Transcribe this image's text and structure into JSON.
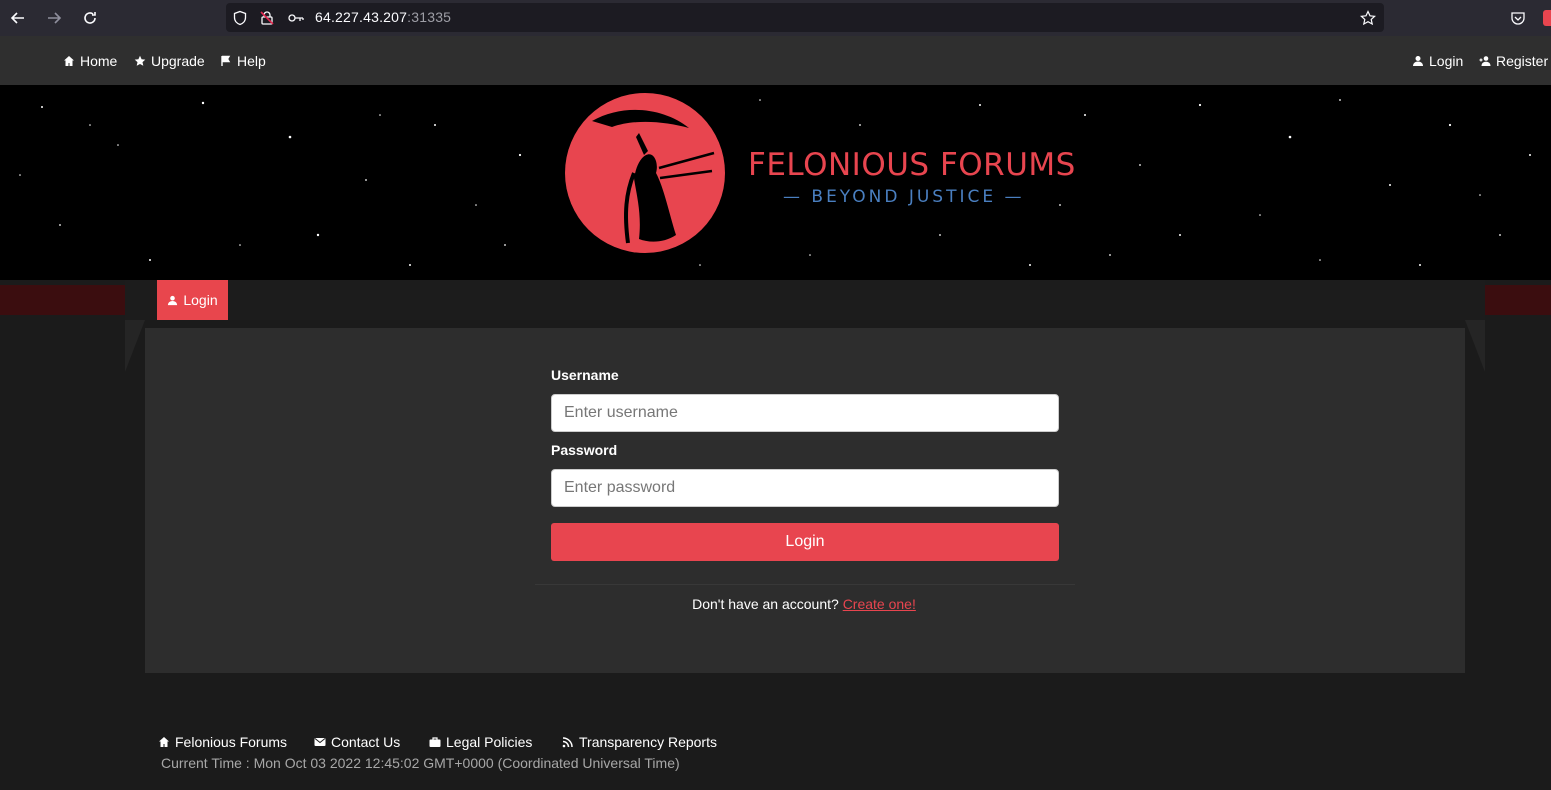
{
  "browser": {
    "url_host": "64.227.43.207",
    "url_port": ":31335"
  },
  "nav": {
    "home": "Home",
    "upgrade": "Upgrade",
    "help": "Help",
    "login": "Login",
    "register": "Register"
  },
  "brand": {
    "title": "FELONIOUS FORUMS",
    "subtitle": "— BEYOND JUSTICE —"
  },
  "tabs": {
    "active": "Login"
  },
  "form": {
    "username_label": "Username",
    "username_placeholder": "Enter username",
    "password_label": "Password",
    "password_placeholder": "Enter password",
    "submit_label": "Login",
    "signup_prompt": "Don't have an account?",
    "signup_link": "Create one!"
  },
  "footer": {
    "links": [
      "Felonious Forums",
      "Contact Us",
      "Legal Policies",
      "Transparency Reports"
    ],
    "time": "Current Time : Mon Oct 03 2022 12:45:02 GMT+0000 (Coordinated Universal Time)"
  },
  "colors": {
    "accent": "#e8454f",
    "subtitle": "#4a7fc0",
    "panel": "#2d2d2d",
    "background": "#1b1b1b"
  }
}
